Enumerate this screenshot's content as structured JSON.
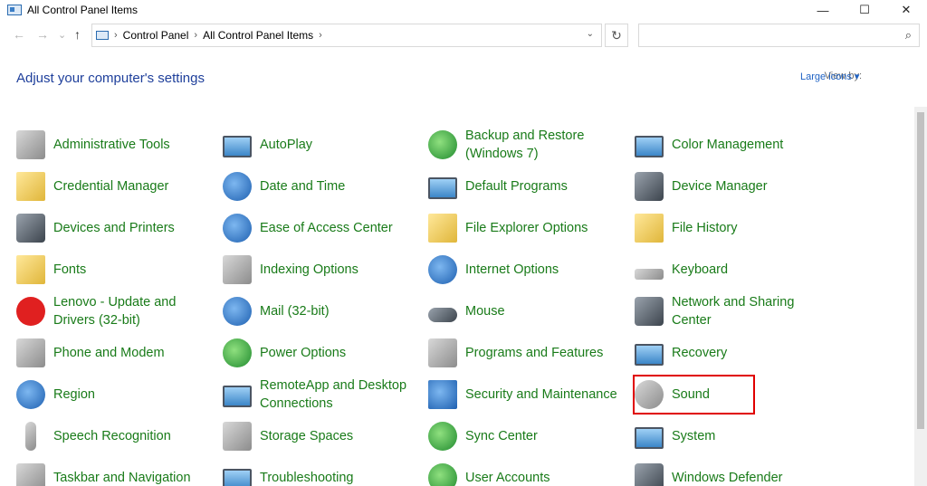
{
  "window": {
    "title": "All Control Panel Items",
    "minimize": "—",
    "maximize": "☐",
    "close": "✕"
  },
  "nav": {
    "back": "←",
    "forward": "→",
    "recent": "⌄",
    "up": "↑",
    "breadcrumbs": [
      "Control Panel",
      "All Control Panel Items"
    ],
    "dropdown": "⌄",
    "refresh": "↻",
    "search_placeholder": "",
    "search_glyph": "⌕"
  },
  "header": {
    "title": "Adjust your computer's settings",
    "view_by_label": "View by:",
    "view_by_value": "Large icons ▾"
  },
  "items": [
    {
      "label": "Administrative Tools",
      "icon": "administrative-tools-icon"
    },
    {
      "label": "AutoPlay",
      "icon": "autoplay-icon"
    },
    {
      "label": "Backup and Restore (Windows 7)",
      "icon": "backup-restore-icon"
    },
    {
      "label": "Color Management",
      "icon": "color-management-icon"
    },
    {
      "label": "Credential Manager",
      "icon": "credential-manager-icon"
    },
    {
      "label": "Date and Time",
      "icon": "date-time-icon"
    },
    {
      "label": "Default Programs",
      "icon": "default-programs-icon"
    },
    {
      "label": "Device Manager",
      "icon": "device-manager-icon"
    },
    {
      "label": "Devices and Printers",
      "icon": "devices-printers-icon"
    },
    {
      "label": "Ease of Access Center",
      "icon": "ease-of-access-icon"
    },
    {
      "label": "File Explorer Options",
      "icon": "file-explorer-options-icon"
    },
    {
      "label": "File History",
      "icon": "file-history-icon"
    },
    {
      "label": "Fonts",
      "icon": "fonts-icon"
    },
    {
      "label": "Indexing Options",
      "icon": "indexing-options-icon"
    },
    {
      "label": "Internet Options",
      "icon": "internet-options-icon"
    },
    {
      "label": "Keyboard",
      "icon": "keyboard-icon"
    },
    {
      "label": "Lenovo - Update and Drivers (32-bit)",
      "icon": "lenovo-update-icon"
    },
    {
      "label": "Mail (32-bit)",
      "icon": "mail-icon"
    },
    {
      "label": "Mouse",
      "icon": "mouse-icon"
    },
    {
      "label": "Network and Sharing Center",
      "icon": "network-sharing-icon"
    },
    {
      "label": "Phone and Modem",
      "icon": "phone-modem-icon"
    },
    {
      "label": "Power Options",
      "icon": "power-options-icon"
    },
    {
      "label": "Programs and Features",
      "icon": "programs-features-icon"
    },
    {
      "label": "Recovery",
      "icon": "recovery-icon"
    },
    {
      "label": "Region",
      "icon": "region-icon"
    },
    {
      "label": "RemoteApp and Desktop Connections",
      "icon": "remoteapp-icon"
    },
    {
      "label": "Security and Maintenance",
      "icon": "security-maintenance-icon"
    },
    {
      "label": "Sound",
      "icon": "sound-icon"
    },
    {
      "label": "Speech Recognition",
      "icon": "speech-recognition-icon"
    },
    {
      "label": "Storage Spaces",
      "icon": "storage-spaces-icon"
    },
    {
      "label": "Sync Center",
      "icon": "sync-center-icon"
    },
    {
      "label": "System",
      "icon": "system-icon"
    },
    {
      "label": "Taskbar and Navigation",
      "icon": "taskbar-navigation-icon"
    },
    {
      "label": "Troubleshooting",
      "icon": "troubleshooting-icon"
    },
    {
      "label": "User Accounts",
      "icon": "user-accounts-icon"
    },
    {
      "label": "Windows Defender",
      "icon": "windows-defender-icon"
    }
  ],
  "colors": {
    "link_green": "#197b19",
    "heading_blue": "#1e3f9b",
    "highlight_red": "#e00000"
  }
}
